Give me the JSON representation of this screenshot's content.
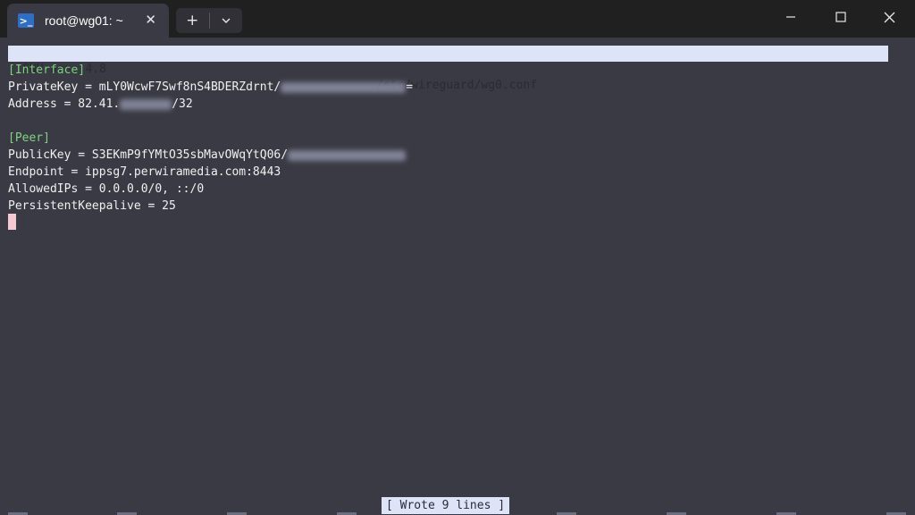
{
  "window": {
    "tab_title": "root@wg01: ~",
    "tab_icon": "terminal-icon",
    "tab_close": "✕",
    "new_tab": "+",
    "colors": {
      "titlebar": "#202020",
      "terminal_bg": "#3a3a44",
      "header_bg": "#dde4f8",
      "section": "#7fd47f",
      "accent": "#2d6ec9"
    }
  },
  "nano": {
    "version": "GNU nano 4.8",
    "filename": "/etc/wireguard/wg0.conf",
    "status": "[ Wrote 9 lines ]"
  },
  "file": {
    "interface_header": "[Interface]",
    "private_key_prefix": "PrivateKey = mLY0WcwF7Swf8nS4BDERZdrnt/",
    "private_key_suffix": "=",
    "address_prefix": "Address = 82.41.",
    "address_suffix": "/32",
    "peer_header": "[Peer]",
    "public_key_prefix": "PublicKey = S3EKmP9fYMtO35sbMavOWqYtQ06/",
    "endpoint": "Endpoint = ippsg7.perwiramedia.com:8443",
    "allowed_ips": "AllowedIPs = 0.0.0.0/0, ::/0",
    "keepalive": "PersistentKeepalive = 25"
  }
}
